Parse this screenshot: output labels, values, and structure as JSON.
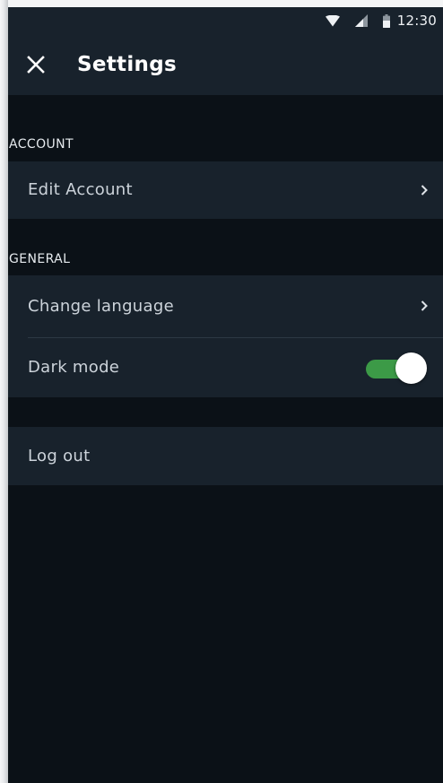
{
  "status_bar": {
    "time": "12:30",
    "icons": [
      "wifi-icon",
      "signal-icon",
      "battery-icon"
    ]
  },
  "app_bar": {
    "close_icon": "close-icon",
    "title": "Settings"
  },
  "sections": {
    "account": {
      "header": "ACCOUNT",
      "items": [
        {
          "label": "Edit Account",
          "trailing": "chevron-right-icon"
        }
      ]
    },
    "general": {
      "header": "GENERAL",
      "items": [
        {
          "label": "Change language",
          "trailing": "chevron-right-icon"
        },
        {
          "label": "Dark mode",
          "trailing": "toggle",
          "enabled": true
        }
      ]
    },
    "session": {
      "items": [
        {
          "label": "Log out"
        }
      ]
    }
  },
  "colors": {
    "background": "#0b1117",
    "surface": "#18222c",
    "toggle_on": "#3c9a47",
    "text_primary": "#ffffff",
    "text_secondary": "#ccd3da"
  }
}
